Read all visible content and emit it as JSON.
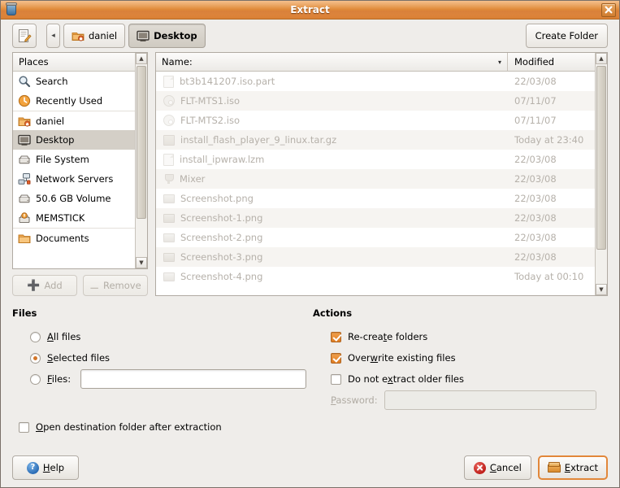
{
  "window": {
    "title": "Extract",
    "title_icon": "archive-jar-icon",
    "close_label": "✖"
  },
  "toolbar": {
    "edit_path_icon": "edit-path-icon",
    "back_label": "◂",
    "breadcrumbs": [
      {
        "label": "daniel",
        "icon": "home-folder-icon",
        "active": false
      },
      {
        "label": "Desktop",
        "icon": "desktop-icon",
        "active": true
      }
    ],
    "create_folder_label": "Create Folder"
  },
  "places": {
    "header": "Places",
    "items": [
      {
        "label": "Search",
        "icon": "search-icon",
        "selected": false,
        "separator": false
      },
      {
        "label": "Recently Used",
        "icon": "recent-clock-icon",
        "selected": false,
        "separator": false
      },
      {
        "label": "daniel",
        "icon": "home-folder-icon",
        "selected": false,
        "separator": true
      },
      {
        "label": "Desktop",
        "icon": "desktop-icon",
        "selected": true,
        "separator": false
      },
      {
        "label": "File System",
        "icon": "harddisk-icon",
        "selected": false,
        "separator": false
      },
      {
        "label": "Network Servers",
        "icon": "network-icon",
        "selected": false,
        "separator": false
      },
      {
        "label": "50.6 GB Volume",
        "icon": "harddisk-icon",
        "selected": false,
        "separator": false
      },
      {
        "label": "MEMSTICK",
        "icon": "removable-media-icon",
        "selected": false,
        "separator": false
      },
      {
        "label": "Documents",
        "icon": "folder-icon",
        "selected": false,
        "separator": true
      }
    ],
    "add_label": "Add",
    "remove_label": "Remove",
    "add_enabled": false,
    "remove_enabled": false
  },
  "filelist": {
    "columns": {
      "name": "Name:",
      "modified": "Modified"
    },
    "sort_arrow": "▾",
    "rows": [
      {
        "name": "bt3b141207.iso.part",
        "modified": "22/03/08",
        "icon": "file-icon"
      },
      {
        "name": "FLT-MTS1.iso",
        "modified": "07/11/07",
        "icon": "cd-image-icon"
      },
      {
        "name": "FLT-MTS2.iso",
        "modified": "07/11/07",
        "icon": "cd-image-icon"
      },
      {
        "name": "install_flash_player_9_linux.tar.gz",
        "modified": "Today at 23:40",
        "icon": "archive-icon"
      },
      {
        "name": "install_ipwraw.lzm",
        "modified": "22/03/08",
        "icon": "file-icon"
      },
      {
        "name": "Mixer",
        "modified": "22/03/08",
        "icon": "application-icon"
      },
      {
        "name": "Screenshot.png",
        "modified": "22/03/08",
        "icon": "image-icon"
      },
      {
        "name": "Screenshot-1.png",
        "modified": "22/03/08",
        "icon": "image-icon"
      },
      {
        "name": "Screenshot-2.png",
        "modified": "22/03/08",
        "icon": "image-icon"
      },
      {
        "name": "Screenshot-3.png",
        "modified": "22/03/08",
        "icon": "image-icon"
      },
      {
        "name": "Screenshot-4.png",
        "modified": "Today at 00:10",
        "icon": "image-icon"
      }
    ]
  },
  "files_section": {
    "title": "Files",
    "all_files_label": "All files",
    "selected_files_label": "Selected files",
    "files_label": "Files:",
    "selected_option": "selected",
    "files_input_value": "",
    "files_input_placeholder": ""
  },
  "actions_section": {
    "title": "Actions",
    "recreate_folders_label": "Re-create folders",
    "recreate_folders_checked": true,
    "overwrite_label": "Overwrite existing files",
    "overwrite_checked": true,
    "do_not_extract_older_label": "Do not extract older files",
    "do_not_extract_older_checked": false,
    "password_label": "Password:",
    "password_value": "",
    "password_enabled": false
  },
  "open_destination": {
    "label": "Open destination folder after extraction",
    "checked": false
  },
  "buttons": {
    "help": "Help",
    "cancel": "Cancel",
    "extract": "Extract"
  },
  "colors": {
    "titlebar_accent": "#dd8434",
    "window_bg": "#efedea",
    "selection": "#d4cfc7",
    "check_accent": "#e07d22",
    "focus_ring": "#e2873a"
  }
}
